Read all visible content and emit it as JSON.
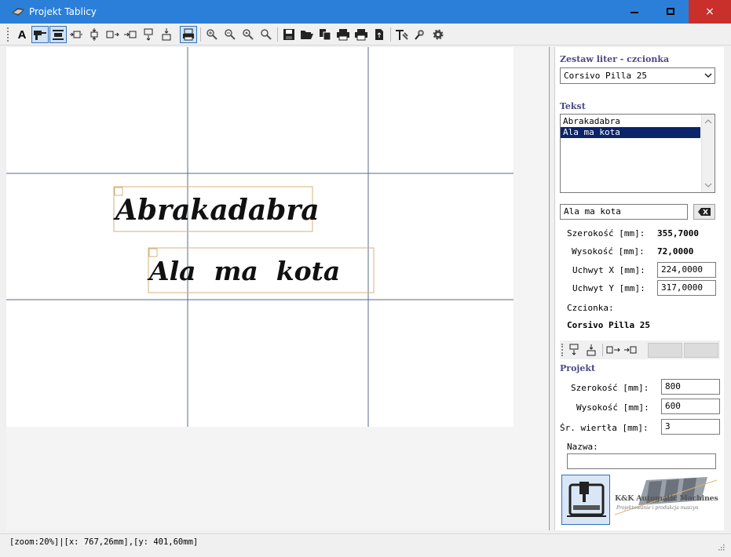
{
  "window": {
    "title": "Projekt Tablicy",
    "minimize": "minimize",
    "maximize": "maximize",
    "close": "×"
  },
  "toolbar": {
    "items": [
      "text-tool",
      "drill-tool",
      "fill-tool",
      "align-left",
      "align-vcenter",
      "align-right-a",
      "align-right-b",
      "align-top",
      "align-bottom",
      "print-preview",
      "zoom-in",
      "zoom-out",
      "zoom-fit",
      "zoom-actual",
      "save",
      "open",
      "copy",
      "print",
      "print-2",
      "export",
      "properties",
      "machine",
      "settings"
    ],
    "text_tool_glyph": "A"
  },
  "panel": {
    "font_section_title": "Zestaw liter - czcionka",
    "font_selected": "Corsivo Pilla 25",
    "text_section_title": "Tekst",
    "text_items": [
      {
        "label": "Abrakadabra",
        "selected": false
      },
      {
        "label": "Ala ma kota",
        "selected": true
      }
    ],
    "text_edit_value": "Ala ma kota",
    "width_label": "Szerokość [mm]:",
    "width_value": "355,7000",
    "height_label": "Wysokość [mm]:",
    "height_value": "72,0000",
    "handle_x_label": "Uchwyt X [mm]:",
    "handle_x_value": "224,0000",
    "handle_y_label": "Uchwyt Y [mm]:",
    "handle_y_value": "317,0000",
    "font_label": "Czcionka:",
    "font_value": "Corsivo Pilla 25",
    "project_title": "Projekt",
    "project_width_label": "Szerokość [mm]:",
    "project_width_value": "800",
    "project_height_label": "Wysokość [mm]:",
    "project_height_value": "600",
    "drill_label": "Śr. wiertła [mm]:",
    "drill_value": "3",
    "name_label": "Nazwa:",
    "name_value": "",
    "brand_line1": "K&K Automatic Machines",
    "brand_line2": "Projektowanie i produkcja maszyn"
  },
  "canvas": {
    "texts": [
      "Abrakadabra",
      "Ala  ma  kota"
    ]
  },
  "status": {
    "text": "[zoom:20%]|[x: 767,26mm],[y: 401,60mm]"
  },
  "colors": {
    "titlebar": "#2b7fd8",
    "close": "#c9302c",
    "selection": "#0b246a",
    "section_title": "#4a4a86",
    "guide": "#5a6a88",
    "bbox": "#d8b27c"
  }
}
